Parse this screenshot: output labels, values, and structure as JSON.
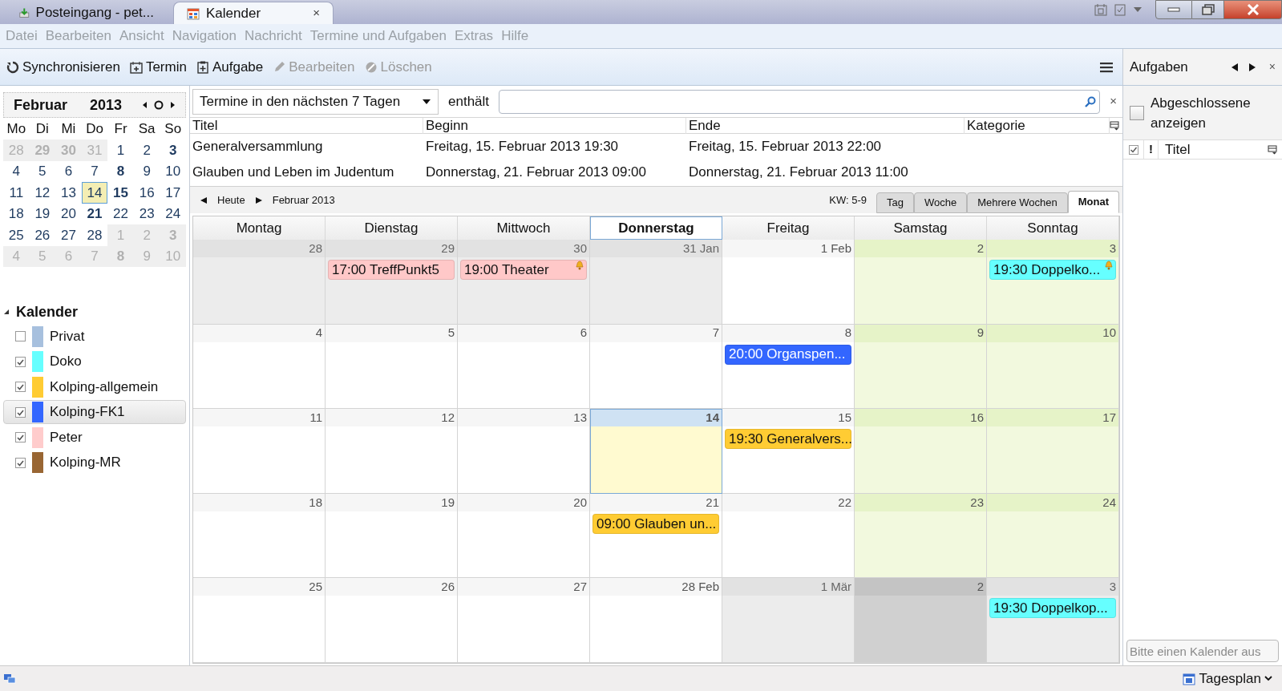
{
  "title_tabs": [
    {
      "label": "Posteingang - pet...",
      "kind": "mail",
      "selected": false
    },
    {
      "label": "Kalender",
      "kind": "calendar",
      "selected": true,
      "close": "×"
    }
  ],
  "menu": [
    "Datei",
    "Bearbeiten",
    "Ansicht",
    "Navigation",
    "Nachricht",
    "Termine und Aufgaben",
    "Extras",
    "Hilfe"
  ],
  "toolbar": [
    {
      "label": "Synchronisieren",
      "kind": "sync",
      "disabled": false
    },
    {
      "label": "Termin",
      "kind": "event",
      "disabled": false
    },
    {
      "label": "Aufgabe",
      "kind": "task",
      "disabled": false
    },
    {
      "label": "Bearbeiten",
      "kind": "edit",
      "disabled": true
    },
    {
      "label": "Löschen",
      "kind": "delete",
      "disabled": true
    }
  ],
  "minical": {
    "month": "Februar",
    "year": "2013",
    "weekdays": [
      "Mo",
      "Di",
      "Mi",
      "Do",
      "Fr",
      "Sa",
      "So"
    ],
    "days": [
      {
        "label": "28",
        "muted": true,
        "bold": false,
        "selected": false
      },
      {
        "label": "29",
        "muted": true,
        "bold": true,
        "selected": false
      },
      {
        "label": "30",
        "muted": true,
        "bold": true,
        "selected": false
      },
      {
        "label": "31",
        "muted": true,
        "bold": false,
        "selected": false
      },
      {
        "label": "1",
        "muted": false,
        "bold": false,
        "selected": false
      },
      {
        "label": "2",
        "muted": false,
        "bold": false,
        "selected": false
      },
      {
        "label": "3",
        "muted": false,
        "bold": true,
        "selected": false
      },
      {
        "label": "4",
        "muted": false,
        "bold": false,
        "selected": false
      },
      {
        "label": "5",
        "muted": false,
        "bold": false,
        "selected": false
      },
      {
        "label": "6",
        "muted": false,
        "bold": false,
        "selected": false
      },
      {
        "label": "7",
        "muted": false,
        "bold": false,
        "selected": false
      },
      {
        "label": "8",
        "muted": false,
        "bold": true,
        "selected": false
      },
      {
        "label": "9",
        "muted": false,
        "bold": false,
        "selected": false
      },
      {
        "label": "10",
        "muted": false,
        "bold": false,
        "selected": false
      },
      {
        "label": "11",
        "muted": false,
        "bold": false,
        "selected": false
      },
      {
        "label": "12",
        "muted": false,
        "bold": false,
        "selected": false
      },
      {
        "label": "13",
        "muted": false,
        "bold": false,
        "selected": false
      },
      {
        "label": "14",
        "muted": false,
        "bold": false,
        "selected": true
      },
      {
        "label": "15",
        "muted": false,
        "bold": true,
        "selected": false
      },
      {
        "label": "16",
        "muted": false,
        "bold": false,
        "selected": false
      },
      {
        "label": "17",
        "muted": false,
        "bold": false,
        "selected": false
      },
      {
        "label": "18",
        "muted": false,
        "bold": false,
        "selected": false
      },
      {
        "label": "19",
        "muted": false,
        "bold": false,
        "selected": false
      },
      {
        "label": "20",
        "muted": false,
        "bold": false,
        "selected": false
      },
      {
        "label": "21",
        "muted": false,
        "bold": true,
        "selected": false
      },
      {
        "label": "22",
        "muted": false,
        "bold": false,
        "selected": false
      },
      {
        "label": "23",
        "muted": false,
        "bold": false,
        "selected": false
      },
      {
        "label": "24",
        "muted": false,
        "bold": false,
        "selected": false
      },
      {
        "label": "25",
        "muted": false,
        "bold": false,
        "selected": false
      },
      {
        "label": "26",
        "muted": false,
        "bold": false,
        "selected": false
      },
      {
        "label": "27",
        "muted": false,
        "bold": false,
        "selected": false
      },
      {
        "label": "28",
        "muted": false,
        "bold": false,
        "selected": false
      },
      {
        "label": "1",
        "muted": true,
        "bold": false,
        "selected": false
      },
      {
        "label": "2",
        "muted": true,
        "bold": false,
        "selected": false
      },
      {
        "label": "3",
        "muted": true,
        "bold": true,
        "selected": false
      },
      {
        "label": "4",
        "muted": true,
        "bold": false,
        "selected": false
      },
      {
        "label": "5",
        "muted": true,
        "bold": false,
        "selected": false
      },
      {
        "label": "6",
        "muted": true,
        "bold": false,
        "selected": false
      },
      {
        "label": "7",
        "muted": true,
        "bold": false,
        "selected": false
      },
      {
        "label": "8",
        "muted": true,
        "bold": true,
        "selected": false
      },
      {
        "label": "9",
        "muted": true,
        "bold": false,
        "selected": false
      },
      {
        "label": "10",
        "muted": true,
        "bold": false,
        "selected": false
      }
    ]
  },
  "calendars": {
    "title": "Kalender",
    "expanded": true,
    "items": [
      {
        "name": "Privat",
        "checked": false,
        "color": "#a7c0de",
        "selected": false
      },
      {
        "name": "Doko",
        "checked": true,
        "color": "#66ffff",
        "selected": false
      },
      {
        "name": "Kolping-allgemein",
        "checked": true,
        "color": "#ffcc33",
        "selected": false
      },
      {
        "name": "Kolping-FK1",
        "checked": true,
        "color": "#3366ff",
        "selected": true
      },
      {
        "name": "Peter",
        "checked": true,
        "color": "#ffcccc",
        "selected": false
      },
      {
        "name": "Kolping-MR",
        "checked": true,
        "color": "#996633",
        "selected": false
      }
    ]
  },
  "filter": {
    "range": "Termine in den nächsten 7 Tagen",
    "contains_label": "enthält",
    "close": "×"
  },
  "event_list": {
    "columns": [
      "Titel",
      "Beginn",
      "Ende",
      "Kategorie"
    ],
    "rows": [
      [
        "Generalversammlung",
        "Freitag, 15. Februar 2013 19:30",
        "Freitag, 15. Februar 2013 22:00"
      ],
      [
        "Glauben und Leben im Judentum",
        "Donnerstag, 21. Februar 2013 09:00",
        "Donnerstag, 21. Februar 2013 11:00"
      ]
    ]
  },
  "nav": {
    "today": "Heute",
    "period": "Februar 2013",
    "week_range": "KW: 5-9",
    "views": [
      {
        "label": "Tag",
        "selected": false
      },
      {
        "label": "Woche",
        "selected": false
      },
      {
        "label": "Mehrere Wochen",
        "selected": false
      },
      {
        "label": "Monat",
        "selected": true
      }
    ]
  },
  "month": {
    "weekdays": [
      {
        "label": "Montag",
        "selected": false
      },
      {
        "label": "Dienstag",
        "selected": false
      },
      {
        "label": "Mittwoch",
        "selected": false
      },
      {
        "label": "Donnerstag",
        "selected": true
      },
      {
        "label": "Freitag",
        "selected": false
      },
      {
        "label": "Samstag",
        "selected": false
      },
      {
        "label": "Sonntag",
        "selected": false
      }
    ],
    "cells": [
      {
        "label": "28",
        "other_month": true,
        "weekend": false,
        "today": false
      },
      {
        "label": "29",
        "other_month": true,
        "weekend": false,
        "today": false,
        "events": [
          {
            "text": "17:00 TreffPunkt5",
            "color": "#ffc8c8",
            "alarm": false
          }
        ]
      },
      {
        "label": "30",
        "other_month": true,
        "weekend": false,
        "today": false,
        "events": [
          {
            "text": "19:00 Theater",
            "color": "#ffc8c8",
            "alarm": true
          }
        ]
      },
      {
        "label": "31 Jan",
        "other_month": true,
        "weekend": false,
        "today": false
      },
      {
        "label": "1 Feb",
        "other_month": false,
        "weekend": false,
        "today": false
      },
      {
        "label": "2",
        "other_month": false,
        "weekend": true,
        "today": false
      },
      {
        "label": "3",
        "other_month": false,
        "weekend": true,
        "today": false,
        "events": [
          {
            "text": "19:30 Doppelko...",
            "color": "#66ffff",
            "alarm": true
          }
        ]
      },
      {
        "label": "4",
        "other_month": false,
        "weekend": false,
        "today": false
      },
      {
        "label": "5",
        "other_month": false,
        "weekend": false,
        "today": false
      },
      {
        "label": "6",
        "other_month": false,
        "weekend": false,
        "today": false
      },
      {
        "label": "7",
        "other_month": false,
        "weekend": false,
        "today": false
      },
      {
        "label": "8",
        "other_month": false,
        "weekend": false,
        "today": false,
        "events": [
          {
            "text": "20:00 Organspen...",
            "color": "#3366ff",
            "alarm": false
          }
        ]
      },
      {
        "label": "9",
        "other_month": false,
        "weekend": true,
        "today": false
      },
      {
        "label": "10",
        "other_month": false,
        "weekend": true,
        "today": false
      },
      {
        "label": "11",
        "other_month": false,
        "weekend": false,
        "today": false
      },
      {
        "label": "12",
        "other_month": false,
        "weekend": false,
        "today": false
      },
      {
        "label": "13",
        "other_month": false,
        "weekend": false,
        "today": false
      },
      {
        "label": "14",
        "other_month": false,
        "weekend": false,
        "today": true
      },
      {
        "label": "15",
        "other_month": false,
        "weekend": false,
        "today": false,
        "events": [
          {
            "text": "19:30 Generalvers...",
            "color": "#ffcc33",
            "alarm": false
          }
        ]
      },
      {
        "label": "16",
        "other_month": false,
        "weekend": true,
        "today": false
      },
      {
        "label": "17",
        "other_month": false,
        "weekend": true,
        "today": false
      },
      {
        "label": "18",
        "other_month": false,
        "weekend": false,
        "today": false
      },
      {
        "label": "19",
        "other_month": false,
        "weekend": false,
        "today": false
      },
      {
        "label": "20",
        "other_month": false,
        "weekend": false,
        "today": false
      },
      {
        "label": "21",
        "other_month": false,
        "weekend": false,
        "today": false,
        "events": [
          {
            "text": "09:00 Glauben un...",
            "color": "#ffcc33",
            "alarm": false
          }
        ]
      },
      {
        "label": "22",
        "other_month": false,
        "weekend": false,
        "today": false
      },
      {
        "label": "23",
        "other_month": false,
        "weekend": true,
        "today": false
      },
      {
        "label": "24",
        "other_month": false,
        "weekend": true,
        "today": false
      },
      {
        "label": "25",
        "other_month": false,
        "weekend": false,
        "today": false
      },
      {
        "label": "26",
        "other_month": false,
        "weekend": false,
        "today": false
      },
      {
        "label": "27",
        "other_month": false,
        "weekend": false,
        "today": false
      },
      {
        "label": "28 Feb",
        "other_month": false,
        "weekend": false,
        "today": false
      },
      {
        "label": "1 Mär",
        "other_month": true,
        "weekend": false,
        "today": false
      },
      {
        "label": "2",
        "other_month": true,
        "weekend": true,
        "today": false
      },
      {
        "label": "3",
        "other_month": true,
        "weekend": false,
        "today": false,
        "events": [
          {
            "text": "19:30 Doppelkop...",
            "color": "#66ffff",
            "alarm": false
          }
        ]
      }
    ]
  },
  "tasks": {
    "title": "Aufgaben",
    "close": "×",
    "show_completed": {
      "label": "Abgeschlossene anzeigen",
      "checked": false
    },
    "columns": {
      "priority": "!",
      "title": "Titel"
    },
    "quick_add": {
      "placeholder": "Bitte einen Kalender aus"
    }
  },
  "status_bar": {
    "mode": "Tagesplan"
  }
}
